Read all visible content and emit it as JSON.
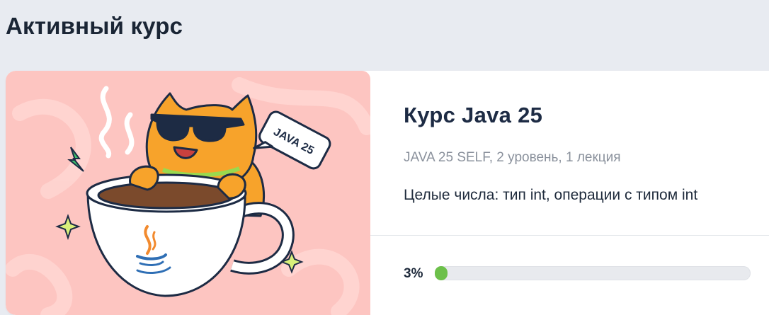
{
  "section": {
    "title": "Активный курс"
  },
  "course": {
    "title": "Курс Java 25",
    "meta": "JAVA 25 SELF, 2 уровень, 1 лекция",
    "lecture_title": "Целые числа: тип int, операции с типом int",
    "illustration_badge": "JAVA 25"
  },
  "progress": {
    "label": "3%",
    "value": 0.03
  },
  "colors": {
    "illustration_bg": "#fdc5c1",
    "cat": "#f7a32b",
    "progress_fill": "#6cc04a"
  }
}
